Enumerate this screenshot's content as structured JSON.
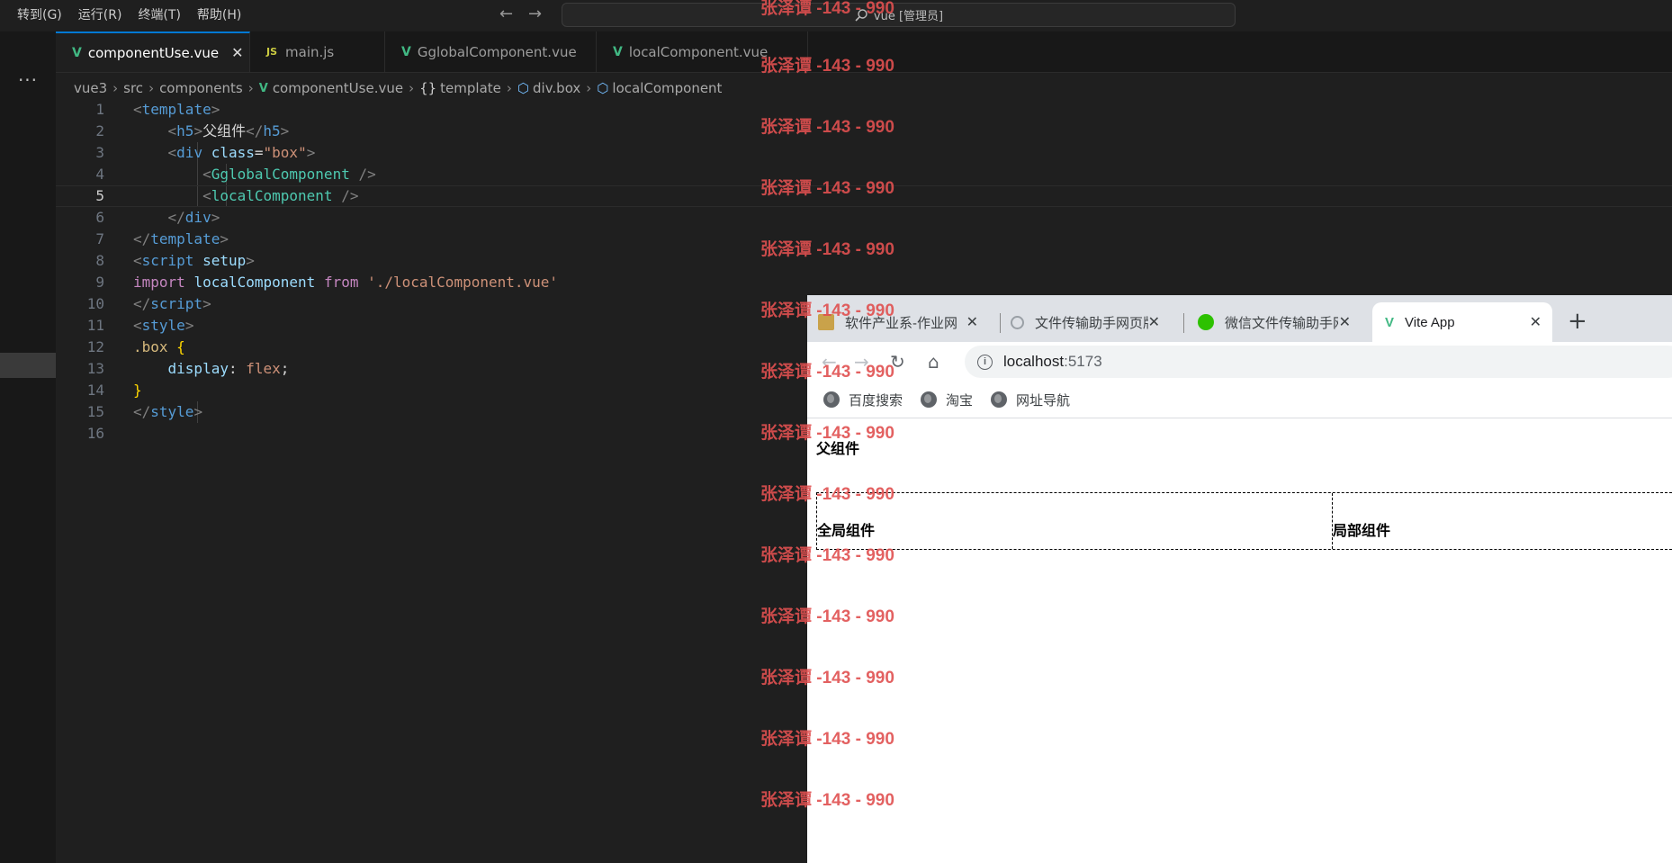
{
  "menu": [
    "转到(G)",
    "运行(R)",
    "终端(T)",
    "帮助(H)"
  ],
  "command_center": "vue [管理员]",
  "activity": {
    "more": "···"
  },
  "tabs": [
    {
      "label": "componentUse.vue",
      "kind": "vue",
      "active": true,
      "close": "✕"
    },
    {
      "label": "main.js",
      "kind": "js",
      "badge": "JS"
    },
    {
      "label": "GglobalComponent.vue",
      "kind": "vue"
    },
    {
      "label": "localComponent.vue",
      "kind": "vue"
    }
  ],
  "breadcrumb": [
    "vue3",
    "src",
    "components",
    "componentUse.vue",
    "template",
    "div.box",
    "localComponent"
  ],
  "breadcrumb_icons": {
    "template": "{}",
    "element": "cube-icon"
  },
  "editor": {
    "line_numbers": [
      "1",
      "2",
      "3",
      "4",
      "5",
      "6",
      "7",
      "8",
      "9",
      "10",
      "11",
      "12",
      "13",
      "14",
      "15",
      "16"
    ],
    "current_line": "5"
  },
  "browser": {
    "tabs": [
      "软件产业系-作业网",
      "文件传输助手网页版",
      "微信文件传输助手网",
      "Vite App"
    ],
    "new_tab": "+",
    "url_host": "localhost",
    "url_port": ":5173",
    "bookmarks": [
      "百度搜索",
      "淘宝",
      "网址导航"
    ],
    "page": {
      "heading": "父组件",
      "global": "全局组件",
      "local": "局部组件"
    }
  },
  "watermark": "张泽谭 -143 - 990"
}
